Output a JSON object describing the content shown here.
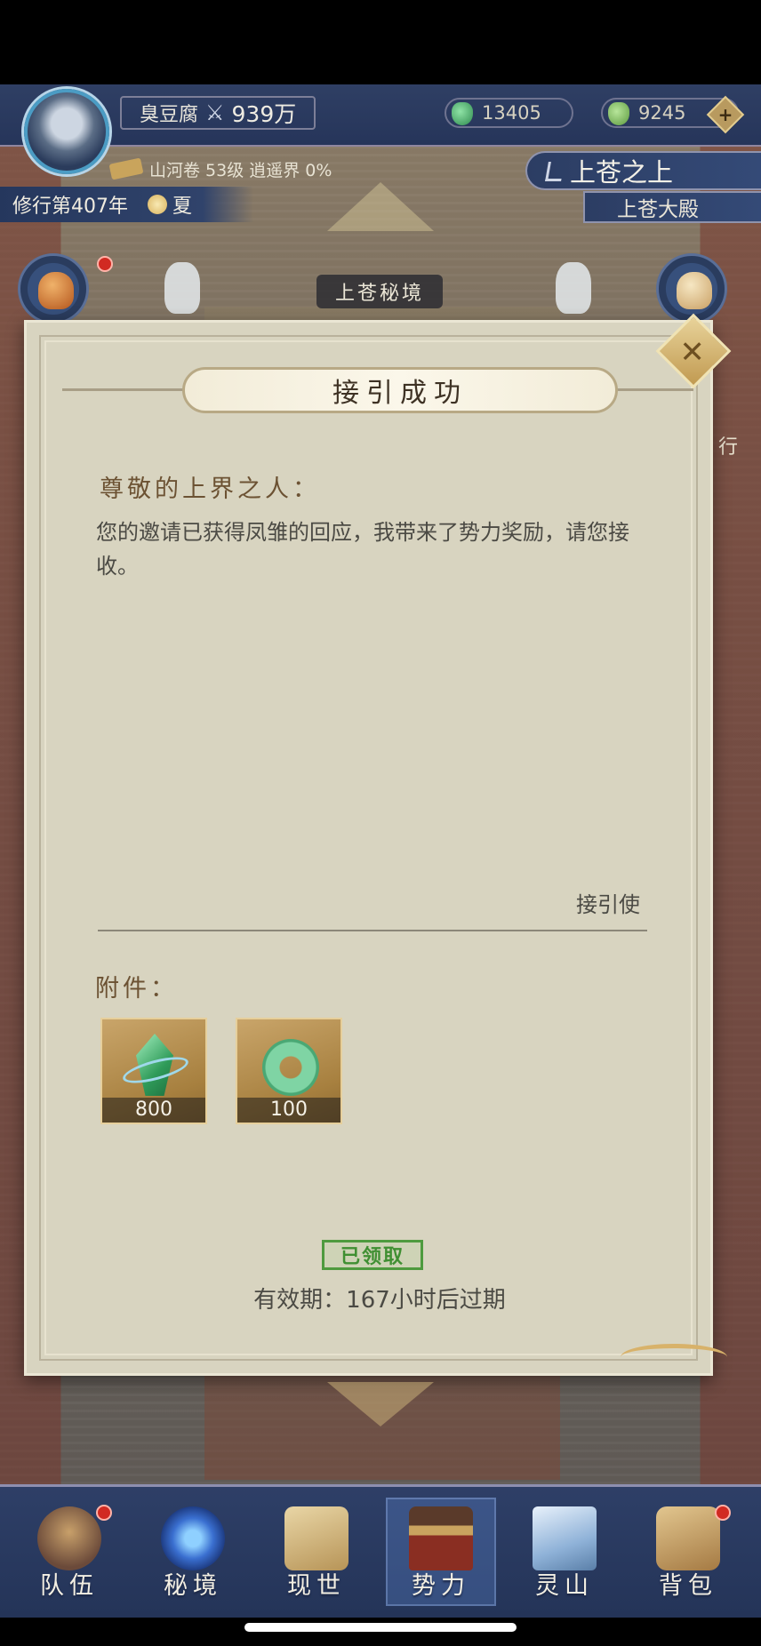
{
  "header": {
    "player_name": "臭豆腐",
    "power_value": "939万",
    "currency_jade": "13405",
    "currency_spirit": "9245",
    "realm_line": "山河卷 53级 逍遥界 0%",
    "cultivation_year": "修行第407年",
    "season": "夏",
    "location": "上苍之上",
    "sub_location": "上苍大殿"
  },
  "scene": {
    "realm_title": "上苍秘境",
    "side_label_right": "行"
  },
  "dialog": {
    "title": "接引成功",
    "greeting": "尊敬的上界之人：",
    "body": "您的邀请已获得凤雏的回应，我带来了势力奖励，请您接收。",
    "signature": "接引使",
    "attachments_label": "附件：",
    "attachments": [
      {
        "icon": "green-crystal-icon",
        "count": "800"
      },
      {
        "icon": "jade-pendant-icon",
        "count": "100"
      }
    ],
    "claimed_stamp": "已领取",
    "expiry": "有效期：167小时后过期"
  },
  "bottom_nav": {
    "items": [
      {
        "label": "队伍",
        "icon": "team-icon",
        "badge": true
      },
      {
        "label": "秘境",
        "icon": "vortex-icon",
        "badge": false
      },
      {
        "label": "现世",
        "icon": "scroll-map-icon",
        "badge": false
      },
      {
        "label": "势力",
        "icon": "palace-icon",
        "badge": false,
        "active": true
      },
      {
        "label": "灵山",
        "icon": "mountain-icon",
        "badge": false
      },
      {
        "label": "背包",
        "icon": "bag-icon",
        "badge": true
      }
    ]
  },
  "colors": {
    "navy": "#2e3f67",
    "parchment": "#d8d4c0",
    "claimed_green": "#3f8f32",
    "badge_red": "#d12a22"
  }
}
